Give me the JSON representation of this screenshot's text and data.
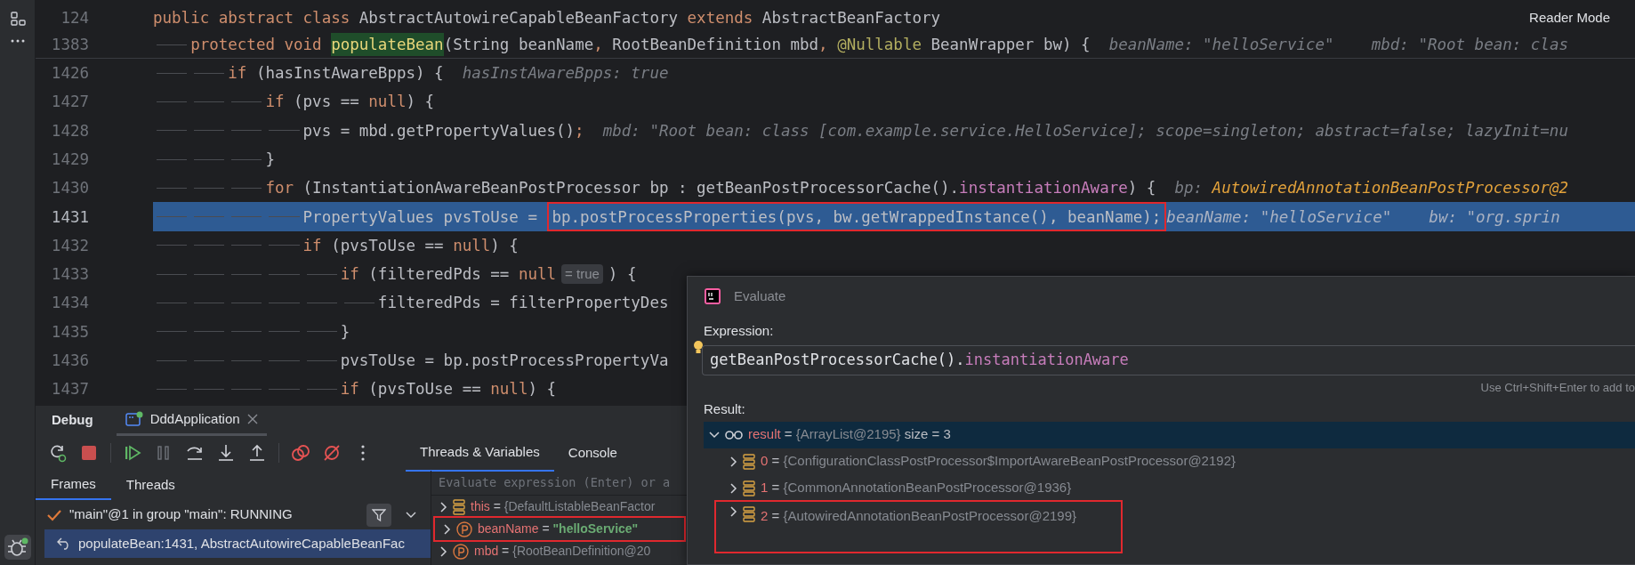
{
  "reader_mode": "Reader Mode",
  "editor": {
    "sticky_lines": [
      {
        "number": "124",
        "segments": [
          {
            "text": "public abstract class ",
            "kind": "kw"
          },
          {
            "text": "AbstractAutowireCapableBeanFactory ",
            "kind": "plain"
          },
          {
            "text": "extends ",
            "kind": "kw"
          },
          {
            "text": "AbstractBeanFactory",
            "kind": "plain"
          }
        ]
      },
      {
        "number": "1383",
        "segments": [
          {
            "text": "    protected void ",
            "kind": "kw"
          },
          {
            "text": "populateBean",
            "kind": "match"
          },
          {
            "text": "(String beanName",
            "kind": "plain"
          },
          {
            "text": ", ",
            "kind": "kw"
          },
          {
            "text": "RootBeanDefinition mbd",
            "kind": "plain"
          },
          {
            "text": ", ",
            "kind": "kw"
          },
          {
            "text": "@Nullable ",
            "kind": "annotation"
          },
          {
            "text": "BeanWrapper bw) {  ",
            "kind": "plain"
          },
          {
            "text": "beanName: \"helloService\"    mbd: \"Root bean: clas",
            "kind": "hint"
          }
        ]
      }
    ],
    "lines": [
      {
        "number": "1426",
        "current": false,
        "segments": [
          {
            "text": "        if ",
            "kind": "kw"
          },
          {
            "text": "(hasInstAwareBpps) {  ",
            "kind": "plain"
          },
          {
            "text": "hasInstAwareBpps: true",
            "kind": "hint"
          }
        ]
      },
      {
        "number": "1427",
        "current": false,
        "segments": [
          {
            "text": "            if ",
            "kind": "kw"
          },
          {
            "text": "(pvs == ",
            "kind": "plain"
          },
          {
            "text": "null",
            "kind": "kw"
          },
          {
            "text": ") {",
            "kind": "plain"
          }
        ]
      },
      {
        "number": "1428",
        "current": false,
        "segments": [
          {
            "text": "                pvs = mbd.getPropertyValues()",
            "kind": "plain"
          },
          {
            "text": ";  ",
            "kind": "kw"
          },
          {
            "text": "mbd: \"Root bean: class [com.example.service.HelloService]; scope=singleton; abstract=false; lazyInit=nu",
            "kind": "hint"
          }
        ]
      },
      {
        "number": "1429",
        "current": false,
        "segments": [
          {
            "text": "            }",
            "kind": "plain"
          }
        ]
      },
      {
        "number": "1430",
        "current": false,
        "segments": [
          {
            "text": "            for ",
            "kind": "kw"
          },
          {
            "text": "(InstantiationAwareBeanPostProcessor bp : getBeanPostProcessorCache().",
            "kind": "plain"
          },
          {
            "text": "instantiationAware",
            "kind": "field"
          },
          {
            "text": ") {  ",
            "kind": "plain"
          },
          {
            "text": "bp: ",
            "kind": "hint"
          },
          {
            "text": "AutowiredAnnotationBeanPostProcessor@2",
            "kind": "hint-object"
          }
        ]
      },
      {
        "number": "1431",
        "current": true,
        "segments": [
          {
            "text": "                PropertyValues pvsToUse = ",
            "kind": "plain"
          },
          {
            "text": "bp.postProcessProperties(pvs, bw.getWrappedInstance(), beanName);",
            "kind": "plain",
            "marked": true
          },
          {
            "text": "  beanName: \"helloService\"    bw: \"org.sprin",
            "kind": "hint"
          }
        ]
      },
      {
        "number": "1432",
        "current": false,
        "segments": [
          {
            "text": "                if ",
            "kind": "kw"
          },
          {
            "text": "(pvsToUse == ",
            "kind": "plain"
          },
          {
            "text": "null",
            "kind": "kw"
          },
          {
            "text": ") {",
            "kind": "plain"
          }
        ]
      },
      {
        "number": "1433",
        "current": false,
        "segments": [
          {
            "text": "                    if ",
            "kind": "kw"
          },
          {
            "text": "(filteredPds == ",
            "kind": "plain"
          },
          {
            "text": "null",
            "kind": "kw"
          },
          {
            "text": "= true",
            "kind": "chip"
          },
          {
            "text": ") {",
            "kind": "plain"
          }
        ]
      },
      {
        "number": "1434",
        "current": false,
        "segments": [
          {
            "text": "                        filteredPds = filterPropertyDes",
            "kind": "plain"
          }
        ]
      },
      {
        "number": "1435",
        "current": false,
        "segments": [
          {
            "text": "                    }",
            "kind": "plain"
          }
        ]
      },
      {
        "number": "1436",
        "current": false,
        "segments": [
          {
            "text": "                    pvsToUse = bp.postProcessPropertyVa",
            "kind": "plain"
          }
        ]
      },
      {
        "number": "1437",
        "current": false,
        "segments": [
          {
            "text": "                    if ",
            "kind": "kw"
          },
          {
            "text": "(pvsToUse == ",
            "kind": "plain"
          },
          {
            "text": "null",
            "kind": "kw"
          },
          {
            "text": ") {",
            "kind": "plain"
          }
        ]
      }
    ]
  },
  "debug": {
    "title": "Debug",
    "session_tabs": [
      {
        "label": "DddApplication",
        "selected": true
      }
    ],
    "view_tabs": [
      {
        "label": "Threads & Variables",
        "selected": true
      },
      {
        "label": "Console",
        "selected": false
      }
    ],
    "frame_tabs": [
      {
        "label": "Frames",
        "selected": true
      },
      {
        "label": "Threads",
        "selected": false
      }
    ],
    "thread": "\"main\"@1 in group \"main\": RUNNING",
    "frames": [
      {
        "text": "populateBean:1431, AbstractAutowireCapableBeanFac",
        "selected": true
      }
    ],
    "evaluate_placeholder": "Evaluate expression (Enter) or a",
    "variables": [
      {
        "kind": "field",
        "name": "this",
        "op": "=",
        "value": "{DefaultListableBeanFactor",
        "is_string": false,
        "marked": false
      },
      {
        "kind": "param",
        "name": "beanName",
        "op": "=",
        "value": "\"helloService\"",
        "is_string": true,
        "marked": true
      },
      {
        "kind": "param",
        "name": "mbd",
        "op": "=",
        "value": "{RootBeanDefinition@20",
        "is_string": false,
        "marked": false
      }
    ]
  },
  "evaluate": {
    "title": "Evaluate",
    "expression_label": "Expression:",
    "expression": [
      {
        "text": "getBeanPostProcessorCache().",
        "kind": "plain"
      },
      {
        "text": "instantiationAware",
        "kind": "field"
      }
    ],
    "hint": "Use Ctrl+Shift+Enter to add to",
    "result_label": "Result:",
    "result": {
      "kind": "watch",
      "name": "result",
      "op": "=",
      "value": "{ArrayList@2195}",
      "extra": "size = 3",
      "expanded": true,
      "selected": true,
      "children": [
        {
          "kind": "field",
          "name": "0",
          "op": "=",
          "value": "{ConfigurationClassPostProcessor$ImportAwareBeanPostProcessor@2192}",
          "expanded": false,
          "marked": false
        },
        {
          "kind": "field",
          "name": "1",
          "op": "=",
          "value": "{CommonAnnotationBeanPostProcessor@1936}",
          "expanded": false,
          "marked": false
        },
        {
          "kind": "field",
          "name": "2",
          "op": "=",
          "value": "{AutowiredAnnotationBeanPostProcessor@2199}",
          "expanded": false,
          "marked": true
        }
      ]
    }
  }
}
